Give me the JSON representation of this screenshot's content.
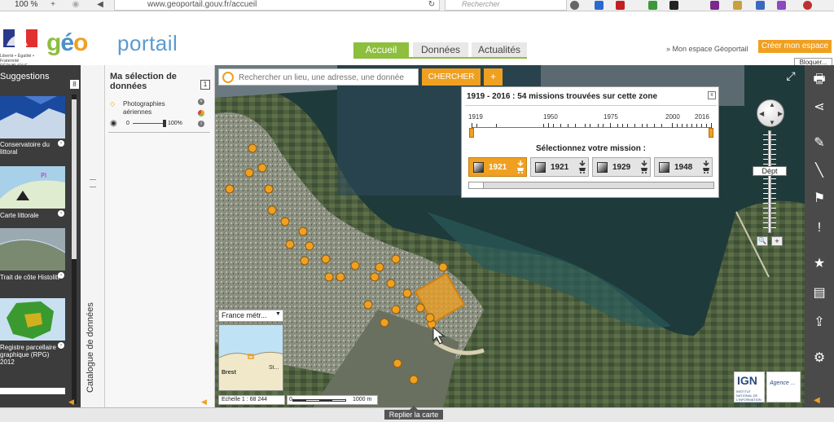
{
  "browser": {
    "zoom": "100 %",
    "url_domain": "www.geoportail.gouv.fr",
    "url_path": "/accueil",
    "search_placeholder": "Rechercher"
  },
  "header": {
    "rf_text": "Liberté • Égalité • Fraternité RÉPUBLIQUE FRANÇAISE",
    "logo_g": "g",
    "logo_e": "é",
    "logo_o": "o",
    "logo_portal": "portail",
    "tabs": [
      "Accueil",
      "Données",
      "Actualités"
    ],
    "mon_espace": "» Mon espace Géoportail",
    "creer": "Créer mon espace",
    "bloquer": "Bloquer..."
  },
  "suggestions": {
    "title": "Suggestions",
    "count": "8",
    "items": [
      {
        "label": "Conservatoire du littoral"
      },
      {
        "label": "Carte littorale"
      },
      {
        "label": "Trait de côte Histolitt"
      },
      {
        "label": "Registre parcellaire graphique (RPG) 2012"
      }
    ]
  },
  "catalogue": {
    "label": "Catalogue de données"
  },
  "selection": {
    "title": "Ma sélection de données",
    "count": "1",
    "layer": "Photographies aériennes",
    "opacity_min": "0",
    "opacity_max": "100%",
    "opacity_value": 1.0
  },
  "search": {
    "placeholder": "Rechercher un lieu, une adresse, une donnée",
    "button": "CHERCHER",
    "plus": "+"
  },
  "mission": {
    "title": "1919 - 2016 : 54 missions trouvées sur cette zone",
    "close": "x",
    "years": [
      "1919",
      "1950",
      "1975",
      "2000",
      "2016"
    ],
    "subtitle": "Sélectionnez votre mission :",
    "buttons": [
      {
        "year": "1921",
        "selected": true
      },
      {
        "year": "1921",
        "selected": false
      },
      {
        "year": "1929",
        "selected": false
      },
      {
        "year": "1948",
        "selected": false
      }
    ],
    "progress": 0.06
  },
  "nav": {
    "dept": "Dépt"
  },
  "minimap": {
    "projection": "France métr...",
    "city1": "Brest",
    "city2": "St...",
    "scale_label": "Echelle 1 : 68 244",
    "scale_min": "0",
    "scale_max": "1000 m"
  },
  "logos": {
    "ign": "IGN",
    "ign_sub": "INSTITUT NATIONAL DE L'INFORMATION GÉOGRAPHIQUE ET FORESTIÈRE",
    "partner": "Agence ..."
  },
  "bottom": {
    "replier": "Replier la carte"
  },
  "colors": {
    "accent": "#f0a020",
    "green": "#8dbe3e",
    "blue": "#4a90c8",
    "dark": "#3c3c3c"
  }
}
